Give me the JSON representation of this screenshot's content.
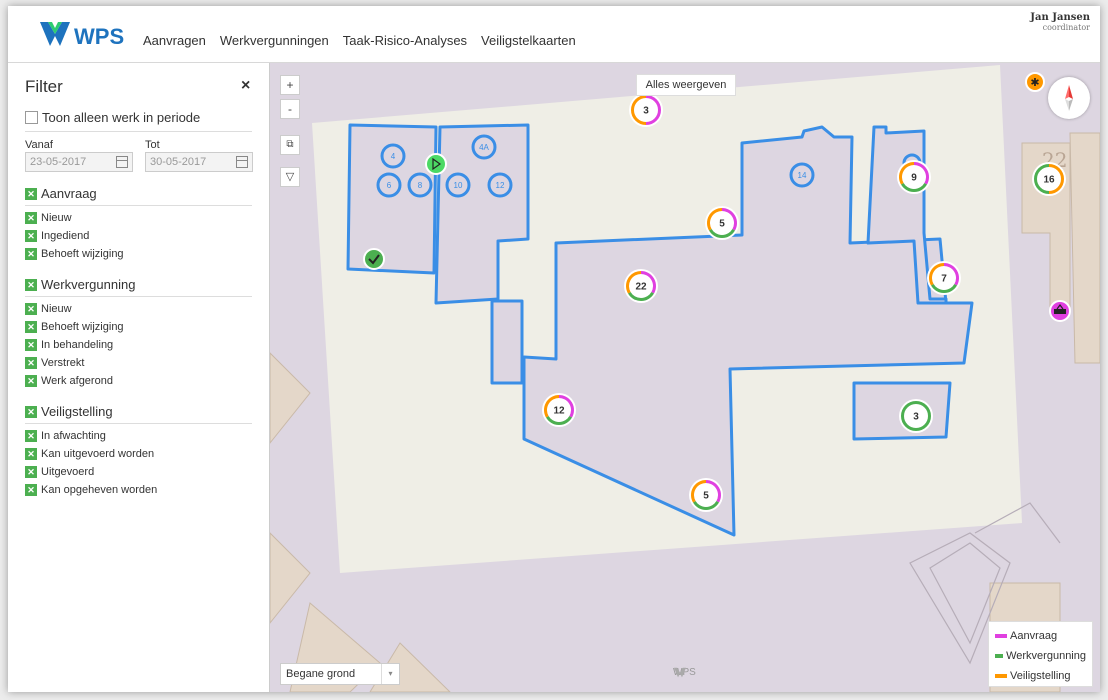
{
  "header": {
    "logo_text": "WPS",
    "nav": [
      "Aanvragen",
      "Werkvergunningen",
      "Taak-Risico-Analyses",
      "Veiligstelkaarten"
    ],
    "user_name": "Jan Jansen",
    "user_role": "coordinator"
  },
  "sidebar": {
    "title": "Filter",
    "close_symbol": "×",
    "period_label": "Toon alleen werk in periode",
    "from_label": "Vanaf",
    "to_label": "Tot",
    "from_value": "23-05-2017",
    "to_value": "30-05-2017",
    "sections": [
      {
        "title": "Aanvraag",
        "items": [
          "Nieuw",
          "Ingediend",
          "Behoeft wijziging"
        ]
      },
      {
        "title": "Werkvergunning",
        "items": [
          "Nieuw",
          "Behoeft wijziging",
          "In behandeling",
          "Verstrekt",
          "Werk afgerond"
        ]
      },
      {
        "title": "Veiligstelling",
        "items": [
          "In afwachting",
          "Kan uitgevoerd worden",
          "Uitgevoerd",
          "Kan opgeheven worden"
        ]
      }
    ]
  },
  "map": {
    "zoom_in": "+",
    "zoom_out": "-",
    "show_all_label": "Alles weergeven",
    "floor_value": "Begane grond",
    "watermark": "WPS",
    "room_labels": [
      "4",
      "4A",
      "6",
      "8",
      "10",
      "12",
      "14"
    ],
    "clusters": [
      {
        "label": "3",
        "colors": [
          "#e040e0",
          "#ff9800"
        ]
      },
      {
        "label": "5",
        "colors": [
          "#e040e0",
          "#4caf50",
          "#ff9800"
        ]
      },
      {
        "label": "22",
        "colors": [
          "#e040e0",
          "#4caf50",
          "#ff9800"
        ]
      },
      {
        "label": "9",
        "colors": [
          "#e040e0",
          "#4caf50",
          "#ff9800"
        ]
      },
      {
        "label": "16",
        "colors": [
          "#ff9800",
          "#4caf50"
        ]
      },
      {
        "label": "7",
        "colors": [
          "#e040e0",
          "#4caf50",
          "#ff9800"
        ]
      },
      {
        "label": "12",
        "colors": [
          "#e040e0",
          "#4caf50",
          "#ff9800"
        ]
      },
      {
        "label": "3",
        "colors": [
          "#4caf50"
        ]
      },
      {
        "label": "5",
        "colors": [
          "#e040e0",
          "#4caf50",
          "#ff9800"
        ]
      }
    ],
    "building_22_label": "22",
    "compass_icon": "compass-icon"
  },
  "legend": [
    {
      "label": "Aanvraag",
      "color": "#e040e0"
    },
    {
      "label": "Werkvergunning",
      "color": "#4caf50"
    },
    {
      "label": "Veiligstelling",
      "color": "#ff9800"
    }
  ],
  "colors": {
    "accent": "#1e73be",
    "floor_plan_border": "#3a8ee6",
    "map_background": "#ddd6e1",
    "paper": "#efeee6"
  }
}
